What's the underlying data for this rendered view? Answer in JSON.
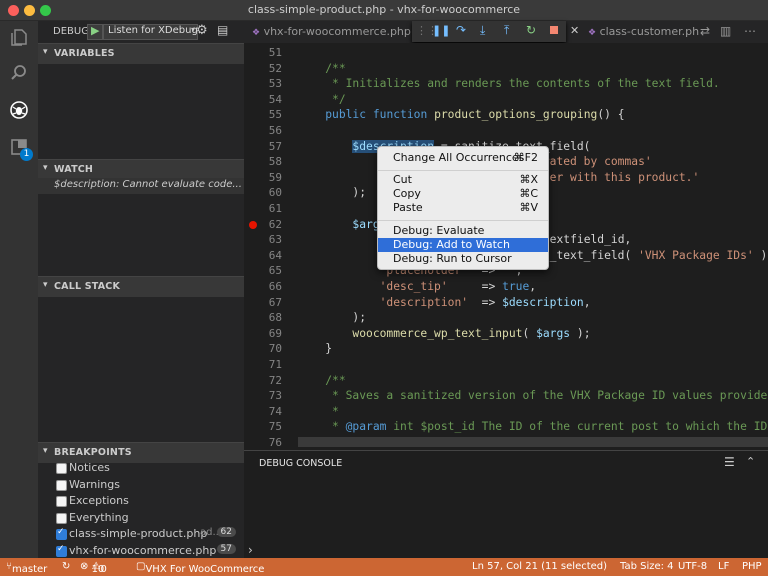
{
  "window": {
    "title": "class-simple-product.php - vhx-for-woocommerce"
  },
  "debug": {
    "label": "DEBUG",
    "config": "Listen for XDebug"
  },
  "sections": {
    "variables": "VARIABLES",
    "watch": "WATCH",
    "call_stack": "CALL STACK",
    "breakpoints": "BREAKPOINTS"
  },
  "watch": {
    "expr": "$description:",
    "value": "Cannot evaluate code..."
  },
  "breakpoints": [
    {
      "label": "Notices",
      "checked": false,
      "count": ""
    },
    {
      "label": "Warnings",
      "checked": false,
      "count": ""
    },
    {
      "label": "Exceptions",
      "checked": false,
      "count": ""
    },
    {
      "label": "Everything",
      "checked": false,
      "count": ""
    },
    {
      "label": "class-simple-product.php",
      "suffix": "ad...",
      "checked": true,
      "count": "62"
    },
    {
      "label": "vhx-for-woocommerce.php",
      "suffix": "",
      "checked": true,
      "count": "57"
    }
  ],
  "tabs": [
    {
      "label": "vhx-for-woocommerce.php"
    },
    {
      "label": "class-customer.ph"
    }
  ],
  "extensions_badge": "1",
  "code_lines": [
    {
      "n": "51",
      "html": ""
    },
    {
      "n": "52",
      "html": "    <span class='cm'>/**</span>"
    },
    {
      "n": "53",
      "html": "     <span class='cm'>* Initializes and renders the contents of the text field.</span>"
    },
    {
      "n": "54",
      "html": "     <span class='cm'>*/</span>"
    },
    {
      "n": "55",
      "html": "    <span class='k'>public</span> <span class='k'>function</span> <span class='f'>product_options_grouping</span>() {"
    },
    {
      "n": "56",
      "html": ""
    },
    {
      "n": "57",
      "html": "        <span class='v sel'>$description</span> = sanitize_text_field("
    },
    {
      "n": "58",
      "html": "            <span class='s'>'Enter multiple IDs separated by commas'</span>"
    },
    {
      "n": "59",
      "html": "            <span class='s'>'to associate the purchaser with this product.'</span>"
    },
    {
      "n": "60",
      "html": "        );"
    },
    {
      "n": "61",
      "html": ""
    },
    {
      "n": "62",
      "html": "        <span class='v'>$args</span> = <span class='k'>array</span>("
    },
    {
      "n": "63",
      "html": "            <span class='s'>'id'</span>          =&gt; <span class='v'>$this</span>-&gt;textfield_id,"
    },
    {
      "n": "64",
      "html": "            <span class='s'>'label'</span>       =&gt; sanitize_text_field( <span class='s'>'VHX Package IDs'</span> ),"
    },
    {
      "n": "65",
      "html": "            <span class='s'>'placeholder'</span>  =&gt; <span class='s'>''</span>,"
    },
    {
      "n": "66",
      "html": "            <span class='s'>'desc_tip'</span>     =&gt; <span class='k'>true</span>,"
    },
    {
      "n": "67",
      "html": "            <span class='s'>'description'</span>  =&gt; <span class='v'>$description</span>,"
    },
    {
      "n": "68",
      "html": "        );"
    },
    {
      "n": "69",
      "html": "        <span class='f'>woocommerce_wp_text_input</span>( <span class='v'>$args</span> );"
    },
    {
      "n": "70",
      "html": "    }"
    },
    {
      "n": "71",
      "html": ""
    },
    {
      "n": "72",
      "html": "    <span class='cm'>/**</span>"
    },
    {
      "n": "73",
      "html": "     <span class='cm'>* Saves a sanitized version of the VHX Package ID values provided by</span>"
    },
    {
      "n": "74",
      "html": "     <span class='cm'>*</span>"
    },
    {
      "n": "75",
      "html": "     <span class='cm'>* <span class='k'>@param</span> int $post_id The ID of the current post to which the IDs are</span>"
    },
    {
      "n": "76",
      "html": "     <span class='cm'>*/</span>"
    }
  ],
  "context_menu": [
    {
      "label": "Change All Occurrences",
      "shortcut": "⌘F2"
    },
    {
      "label": "Cut",
      "shortcut": "⌘X"
    },
    {
      "label": "Copy",
      "shortcut": "⌘C"
    },
    {
      "label": "Paste",
      "shortcut": "⌘V"
    },
    {
      "label": "Debug: Evaluate",
      "shortcut": ""
    },
    {
      "label": "Debug: Add to Watch",
      "shortcut": ""
    },
    {
      "label": "Debug: Run to Cursor",
      "shortcut": ""
    }
  ],
  "console": {
    "title": "DEBUG CONSOLE",
    "prompt": "›"
  },
  "status": {
    "branch": "master",
    "errors": "10",
    "warnings": "0",
    "project": "VHX For WooCommerce",
    "position": "Ln 57, Col 21 (11 selected)",
    "tab_size": "Tab Size: 4",
    "encoding": "UTF-8",
    "eol": "LF",
    "language": "PHP"
  },
  "colors": {
    "status_bar": "#cc6633",
    "accent": "#007acc",
    "breakpoint": "#e51400"
  }
}
